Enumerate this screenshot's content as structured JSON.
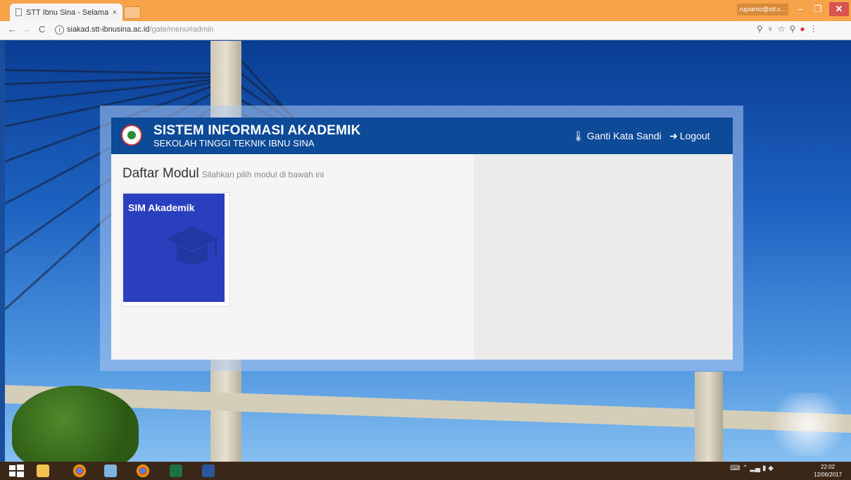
{
  "browser": {
    "tab_title": "STT Ibnu Sina - Selamat",
    "tab_close": "×",
    "profile_name": "rupianto@stt.c...",
    "url_host": "siakad.stt-ibnusina.ac.id",
    "url_path": "/gate/menu#admin"
  },
  "header": {
    "title": "SISTEM INFORMASI AKADEMIK",
    "subtitle": "SEKOLAH TINGGI TEKNIK IBNU SINA",
    "change_password": "Ganti Kata Sandi",
    "logout": "Logout"
  },
  "main": {
    "section_title": "Daftar Modul",
    "section_subtitle": "Silahkan pilih modul di bawah ini",
    "modules": [
      {
        "label": "SIM Akademik",
        "color": "#2a3fbd",
        "icon": "graduation-cap-icon"
      }
    ]
  },
  "taskbar": {
    "time": "22:02",
    "date": "12/06/2017"
  },
  "colors": {
    "header_bg": "#0d4a97",
    "module_tile": "#2a3fbd",
    "browser_chrome": "#f6a34a",
    "close_button": "#d9534f"
  }
}
